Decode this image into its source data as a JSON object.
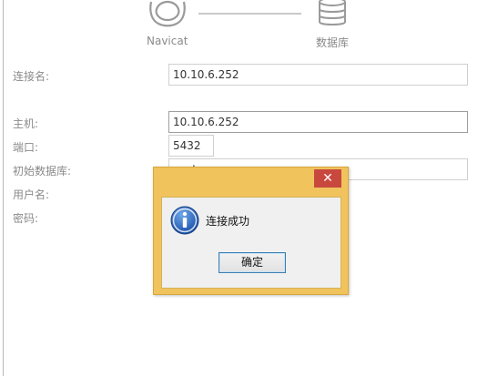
{
  "diagram": {
    "source_label": "Navicat",
    "target_label": "数据库"
  },
  "form": {
    "connection_name": {
      "label": "连接名:",
      "value": "10.10.6.252"
    },
    "host": {
      "label": "主机:",
      "value": "10.10.6.252"
    },
    "port": {
      "label": "端口:",
      "value": "5432"
    },
    "initial_database": {
      "label": "初始数据库:",
      "value": "postgres"
    },
    "username": {
      "label": "用户名:"
    },
    "password": {
      "label": "密码:"
    }
  },
  "dialog": {
    "message": "连接成功",
    "ok_label": "确定",
    "close_glyph": "✕",
    "title_color": "#f0c35d",
    "close_color": "#c9483e"
  },
  "icons": [
    "navicat-icon",
    "database-icon",
    "info-icon",
    "close-icon"
  ]
}
